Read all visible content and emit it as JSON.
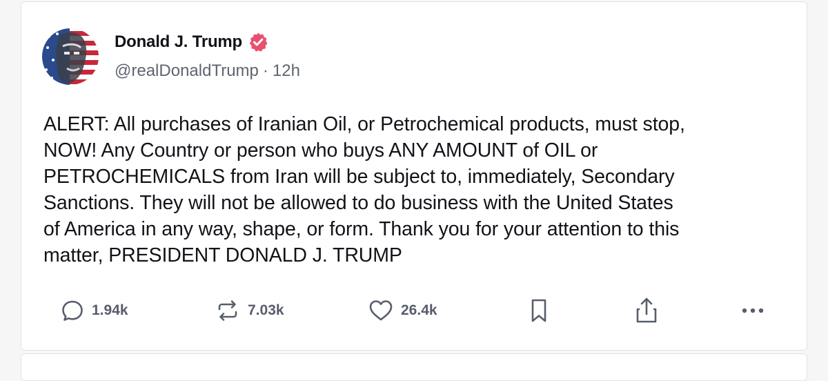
{
  "post": {
    "author": {
      "display_name": "Donald J. Trump",
      "handle": "@realDonaldTrump",
      "verified_badge_color": "#e8506e"
    },
    "meta_separator": "·",
    "time_ago": "12h",
    "text": "ALERT: All purchases of Iranian Oil, or Petrochemical products, must stop,\nNOW! Any Country or person who buys ANY AMOUNT of OIL or\nPETROCHEMICALS from Iran will be subject to, immediately, Secondary\nSanctions. They will not be allowed to do business with the United States\nof America in any way, shape, or form. Thank you for your attention to this\nmatter, PRESIDENT DONALD J. TRUMP",
    "actions": {
      "reply_count": "1.94k",
      "repost_count": "7.03k",
      "like_count": "26.4k"
    },
    "icons": [
      "reply-icon",
      "repost-icon",
      "like-icon",
      "bookmark-icon",
      "share-icon",
      "more-icon"
    ]
  }
}
